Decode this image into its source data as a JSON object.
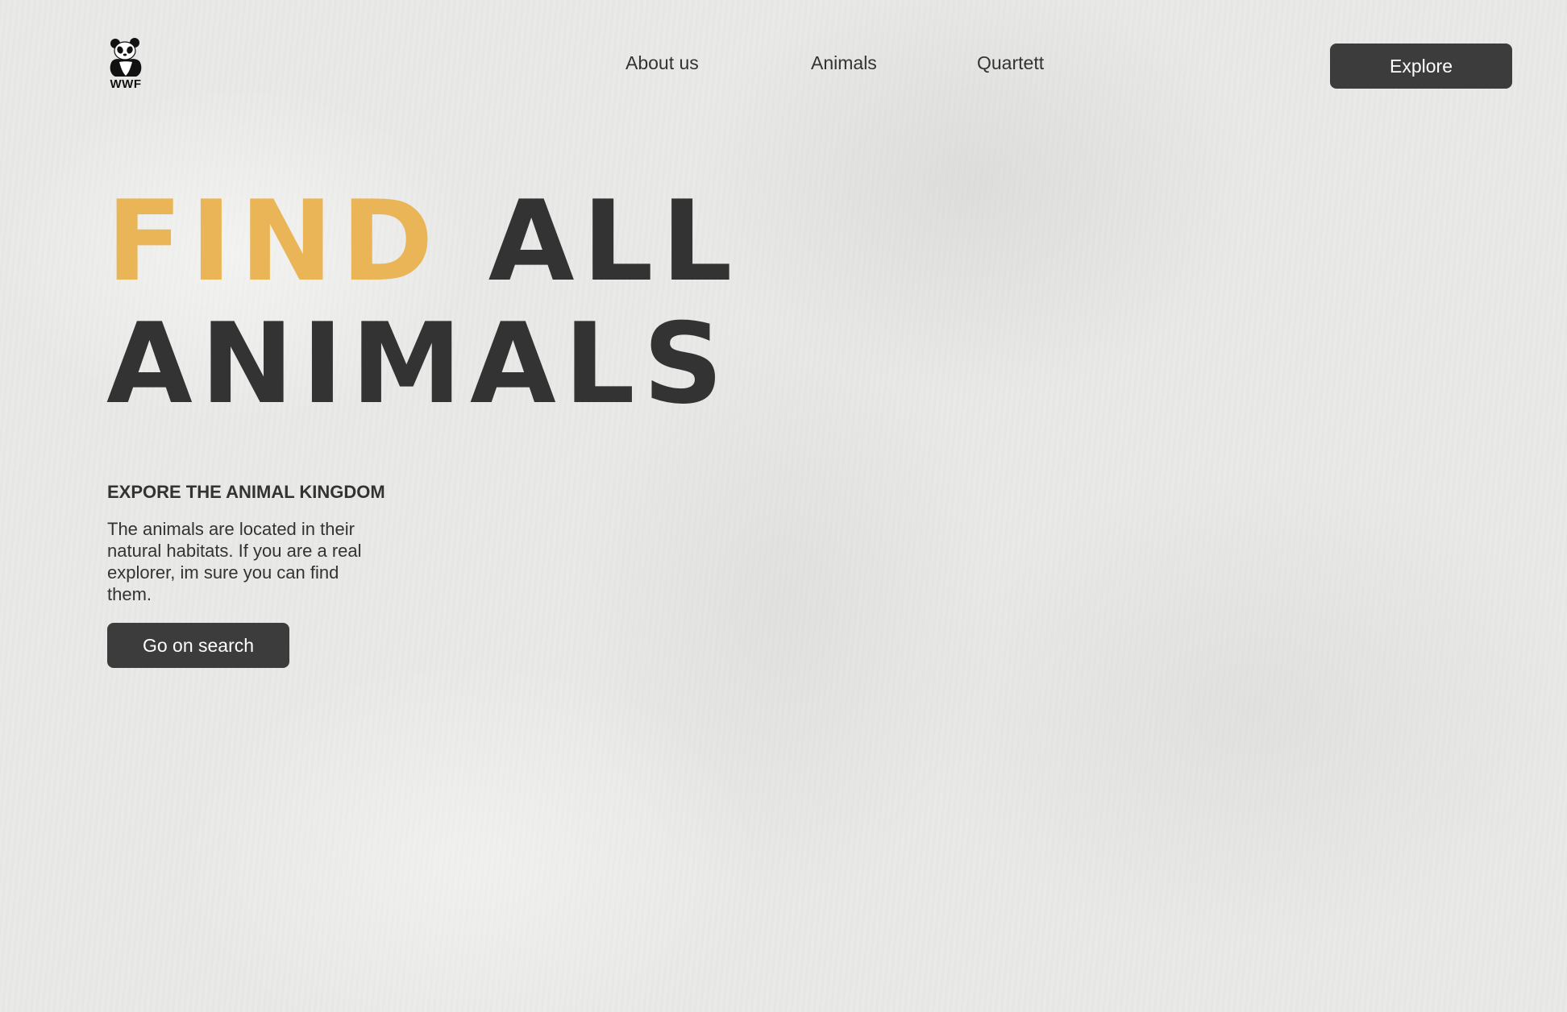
{
  "header": {
    "logo": {
      "text": "WWF",
      "icon": "panda-icon"
    },
    "nav": [
      {
        "label": "About us"
      },
      {
        "label": "Animals"
      },
      {
        "label": "Quartett"
      }
    ],
    "cta_label": "Explore"
  },
  "hero": {
    "title_accent": "FIND",
    "title_rest": "ALL",
    "title_line2": "ANIMALS",
    "subheading": "EXPORE THE ANIMAL KINGDOM",
    "description": "The animals are located in their natural habitats. If you are a real explorer, im sure you can find them.",
    "button_label": "Go on search"
  },
  "colors": {
    "accent": "#e9b556",
    "text": "#333333",
    "button": "#3c3c3c",
    "background": "#e9e9e7"
  }
}
